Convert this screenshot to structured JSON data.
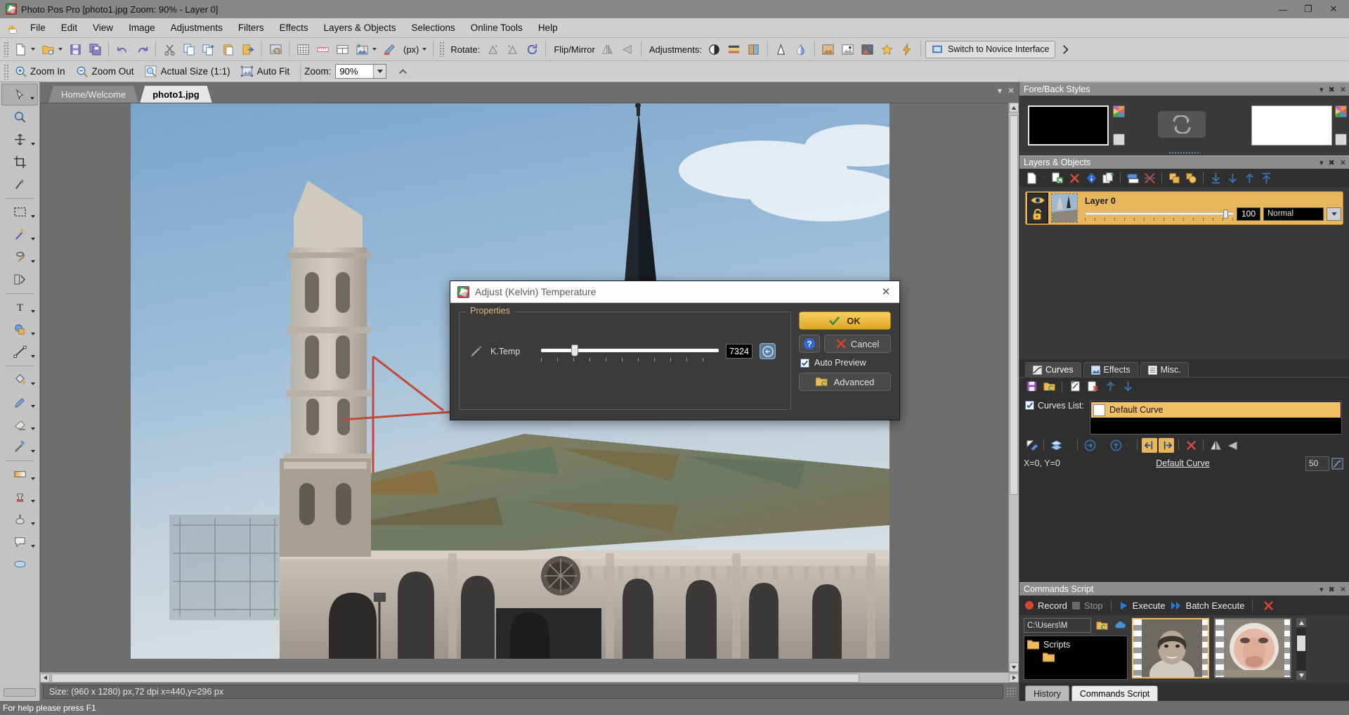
{
  "window": {
    "title": "Photo Pos Pro [photo1.jpg Zoom: 90% - Layer 0]",
    "minimize": "—",
    "maximize": "❐",
    "close": "✕"
  },
  "menubar": {
    "items": [
      {
        "label": "File"
      },
      {
        "label": "Edit"
      },
      {
        "label": "View"
      },
      {
        "label": "Image"
      },
      {
        "label": "Adjustments"
      },
      {
        "label": "Filters"
      },
      {
        "label": "Effects"
      },
      {
        "label": "Layers & Objects"
      },
      {
        "label": "Selections"
      },
      {
        "label": "Online Tools"
      },
      {
        "label": "Help"
      }
    ]
  },
  "toolbar": {
    "rotate_label": "Rotate:",
    "flip_label": "Flip/Mirror",
    "adjustments_label": "Adjustments:",
    "unit_label": "(px)",
    "switch_interface": "Switch to Novice Interface"
  },
  "zoombar": {
    "zoom_in": "Zoom In",
    "zoom_out": "Zoom Out",
    "actual_size": "Actual Size (1:1)",
    "auto_fit": "Auto Fit",
    "zoom_label": "Zoom:",
    "zoom_value": "90%"
  },
  "doc_tabs": [
    {
      "label": "Home/Welcome",
      "active": false
    },
    {
      "label": "photo1.jpg",
      "active": true
    }
  ],
  "statusbar": {
    "text": "Size: (960 x 1280) px,72 dpi   x=440,y=296 px"
  },
  "helpbar": {
    "text": "For help please press F1"
  },
  "dialog": {
    "title": "Adjust (Kelvin) Temperature",
    "close": "✕",
    "properties_legend": "Properties",
    "slider_label": "K.Temp",
    "slider_value": "7324",
    "ok_label": "OK",
    "cancel_label": "Cancel",
    "help_label": "?",
    "auto_preview_label": "Auto Preview",
    "auto_preview_checked": true,
    "advanced_label": "Advanced"
  },
  "panels": {
    "foreback": {
      "title": "Fore/Back Styles",
      "fore_color": "#000000",
      "back_color": "#ffffff"
    },
    "layers": {
      "title": "Layers & Objects",
      "rows": [
        {
          "name": "Layer 0",
          "opacity": "100",
          "blend": "Normal",
          "visible": true,
          "locked": false
        }
      ]
    },
    "curves": {
      "tabs": [
        {
          "label": "Curves",
          "active": true
        },
        {
          "label": "Effects",
          "active": false
        },
        {
          "label": "Misc.",
          "active": false
        }
      ],
      "curves_list_label": "Curves List:",
      "curves_list_checked": true,
      "items": [
        {
          "label": "Default Curve",
          "selected": true
        }
      ],
      "coords": "X=0, Y=0",
      "current_curve": "Default Curve",
      "value": "50"
    },
    "commands": {
      "title": "Commands Script",
      "record": "Record",
      "stop": "Stop",
      "execute": "Execute",
      "batch_execute": "Batch Execute",
      "path": "C:\\Users\\M",
      "tree_root": "Scripts",
      "tabs": [
        {
          "label": "History",
          "active": false
        },
        {
          "label": "Commands Script",
          "active": true
        }
      ]
    }
  },
  "colors": {
    "accent_gold": "#e8b75c",
    "panel_dark": "#3a3a3a",
    "chrome_gray": "#cfcfcf",
    "canvas_gray": "#6e6e6e",
    "title_gray": "#888887"
  }
}
